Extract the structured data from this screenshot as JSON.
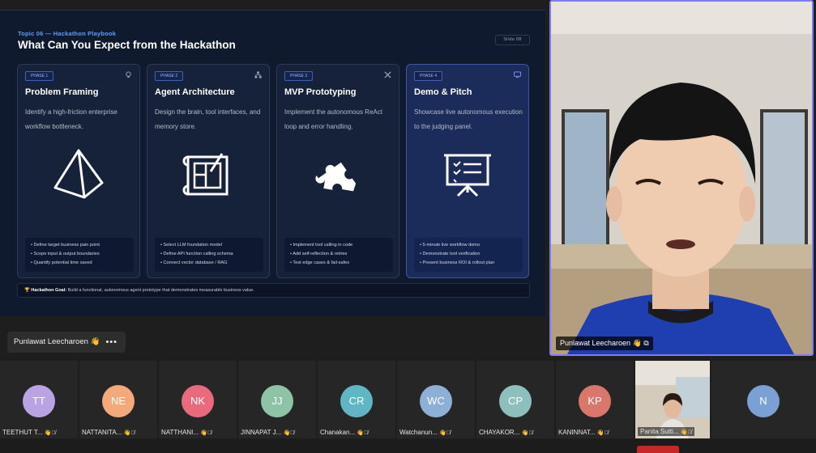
{
  "slide": {
    "topic": "Topic 06 — Hackathon Playbook",
    "title": "What Can You Expect from the Hackathon",
    "slide_number": "Slide 08",
    "cards": [
      {
        "phase": "PHASE 1",
        "title": "Problem Framing",
        "desc": "Identify a high-friction enterprise workflow bottleneck.",
        "icon": "pyramid-icon",
        "bullets": [
          "• Define target business pain point",
          "• Scope input & output boundaries",
          "• Quantify potential time saved"
        ]
      },
      {
        "phase": "PHASE 2",
        "title": "Agent Architecture",
        "desc": "Design the brain, tool interfaces, and memory store.",
        "icon": "blueprint-icon",
        "bullets": [
          "• Select LLM foundation model",
          "• Define API function calling schema",
          "• Connect vector database / RAG"
        ]
      },
      {
        "phase": "PHASE 3",
        "title": "MVP Prototyping",
        "desc": "Implement the autonomous ReAct loop and error handling.",
        "icon": "puzzle-icon",
        "bullets": [
          "• Implement tool calling in code",
          "• Add self-reflection & retries",
          "• Test edge cases & fail-safes"
        ]
      },
      {
        "phase": "PHASE 4",
        "title": "Demo & Pitch",
        "desc": "Showcase live autonomous execution to the judging panel.",
        "icon": "presentation-board-icon",
        "bullets": [
          "• 5-minute live workflow demo",
          "• Demonstrate tool verification",
          "• Present business ROI & rollout plan"
        ]
      }
    ],
    "goal_label": "Hackathon Goal:",
    "goal_text": "Build a functional, autonomous agent prototype that demonstrates measurable business value."
  },
  "speaker": {
    "name": "Punlawat Leecharoen",
    "status_icons": "👋 ⧉"
  },
  "self_pill": {
    "name": "Punlawat Leecharoen",
    "more": "•••"
  },
  "participants": [
    {
      "initials": "TT",
      "name": "TEETHUT T...",
      "color": "#b9a3e3"
    },
    {
      "initials": "NE",
      "name": "NATTANITA...",
      "color": "#f4a97a"
    },
    {
      "initials": "NK",
      "name": "NATTHANI...",
      "color": "#e96a7d"
    },
    {
      "initials": "JJ",
      "name": "JINNAPAT J...",
      "color": "#8fc3a8"
    },
    {
      "initials": "CR",
      "name": "Chanakan...",
      "color": "#5fb6c5"
    },
    {
      "initials": "WC",
      "name": "Watchanun...",
      "color": "#8fb0d6"
    },
    {
      "initials": "CP",
      "name": "CHAYAKOR...",
      "color": "#8dc0bd"
    },
    {
      "initials": "KP",
      "name": "KANINNAT...",
      "color": "#d9786a"
    },
    {
      "initials": "",
      "name": "Panita Sutti...",
      "color": "#8a8a8a"
    },
    {
      "initials": "N",
      "name": "",
      "color": "#7aa0d4"
    }
  ]
}
